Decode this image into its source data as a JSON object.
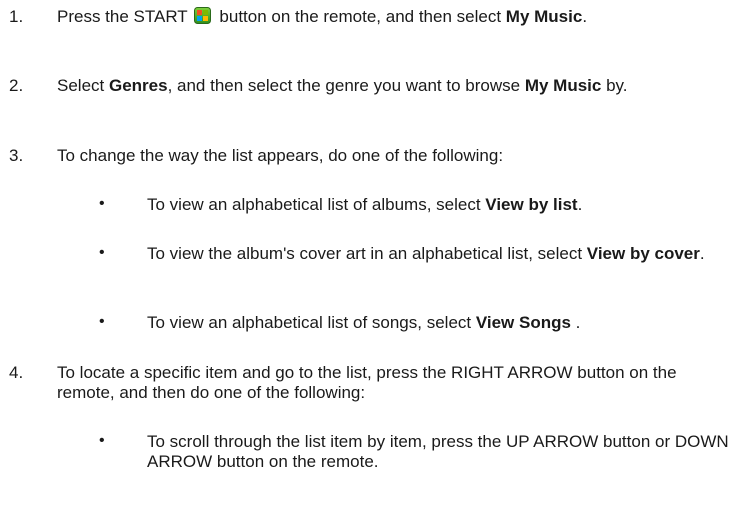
{
  "steps": [
    {
      "num": "1.",
      "text_a": "Press the START",
      "text_b": " button on the remote, and then select ",
      "bold_b": "My Music",
      "text_c": "."
    },
    {
      "num": "2.",
      "text_a": "Select ",
      "bold_a": "Genres",
      "text_b": ", and then select the genre you want to browse ",
      "bold_b": "My Music",
      "text_c": " by."
    },
    {
      "num": "3.",
      "text_a": "To change the way the list appears, do one of the following:"
    },
    {
      "num": "4.",
      "text_a": "To locate a specific item and go to the list, press the RIGHT ARROW button on the remote, and then do one of the following:"
    }
  ],
  "step3_bullets": [
    {
      "text": "To view an alphabetical list of albums, select ",
      "bold": "View by list",
      "end": "."
    },
    {
      "text": "To view the album's cover art in an alphabetical list, select ",
      "bold": "View by cover",
      "end": "."
    },
    {
      "text": "To view an alphabetical list of songs, select ",
      "bold": "View Songs",
      "end": " ."
    }
  ],
  "step4_bullets": [
    {
      "text": "To scroll through the list item by item, press the UP ARROW button or DOWN ARROW button on the remote."
    }
  ],
  "bullet_glyph": "•",
  "icons": {
    "start_button": "windows-start-icon"
  }
}
